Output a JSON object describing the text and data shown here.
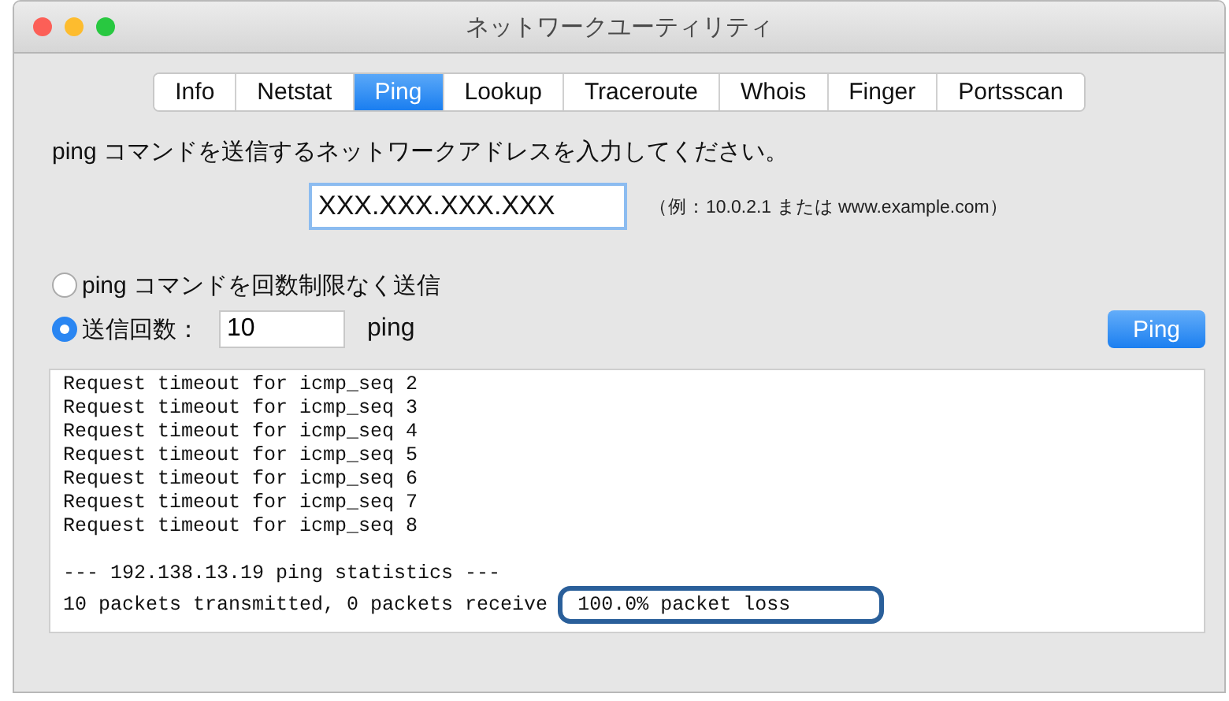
{
  "window": {
    "title": "ネットワークユーティリティ"
  },
  "tabs": [
    {
      "label": "Info",
      "selected": false
    },
    {
      "label": "Netstat",
      "selected": false
    },
    {
      "label": "Ping",
      "selected": true
    },
    {
      "label": "Lookup",
      "selected": false
    },
    {
      "label": "Traceroute",
      "selected": false
    },
    {
      "label": "Whois",
      "selected": false
    },
    {
      "label": "Finger",
      "selected": false
    },
    {
      "label": "Portsscan",
      "selected": false
    }
  ],
  "prompt": "ping コマンドを送信するネットワークアドレスを入力してください。",
  "address": {
    "value": "XXX.XXX.XXX.XXX",
    "hint": "（例：10.0.2.1 または www.example.com）"
  },
  "options": [
    {
      "label": "ping コマンドを回数制限なく送信",
      "selected": false
    },
    {
      "label": "送信回数：",
      "selected": true,
      "count": "10",
      "unit": "ping"
    }
  ],
  "ping_button": "Ping",
  "output": {
    "lines": [
      "Request timeout for icmp_seq 2",
      "Request timeout for icmp_seq 3",
      "Request timeout for icmp_seq 4",
      "Request timeout for icmp_seq 5",
      "Request timeout for icmp_seq 6",
      "Request timeout for icmp_seq 7",
      "Request timeout for icmp_seq 8"
    ],
    "stats_line": "--- 192.138.13.19 ping statistics ---",
    "last_line": "10 packets transmitted, 0 packets receive",
    "highlight": "100.0% packet loss"
  }
}
